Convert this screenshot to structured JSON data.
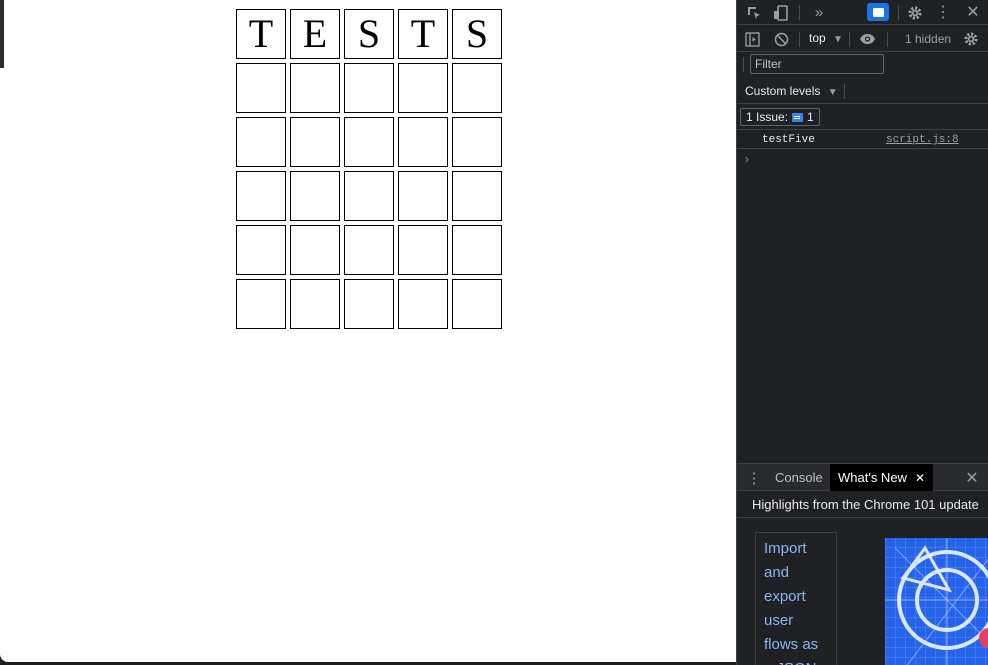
{
  "page": {
    "board": {
      "rows": [
        [
          "T",
          "E",
          "S",
          "T",
          "S"
        ],
        [
          "",
          "",
          "",
          "",
          ""
        ],
        [
          "",
          "",
          "",
          "",
          ""
        ],
        [
          "",
          "",
          "",
          "",
          ""
        ],
        [
          "",
          "",
          "",
          "",
          ""
        ],
        [
          "",
          "",
          "",
          "",
          ""
        ]
      ]
    }
  },
  "devtools": {
    "toolbar": {
      "context_selector": "top",
      "hidden_count": "1 hidden"
    },
    "filter": {
      "placeholder": "Filter"
    },
    "levels": {
      "label": "Custom levels"
    },
    "issues": {
      "label": "1 Issue:",
      "count": "1"
    },
    "console": {
      "messages": [
        {
          "text": "testFive",
          "source": "script.js:8"
        }
      ],
      "prompt": "›"
    },
    "drawer": {
      "tabs": [
        {
          "label": "Console"
        },
        {
          "label": "What's New"
        }
      ],
      "highlights_title": "Highlights from the Chrome 101 update",
      "card_link": "Import and export user flows as a JSON file"
    },
    "accent_color": "#3b82f6",
    "link_color": "#8ab4f8",
    "background_color": "#202124"
  }
}
